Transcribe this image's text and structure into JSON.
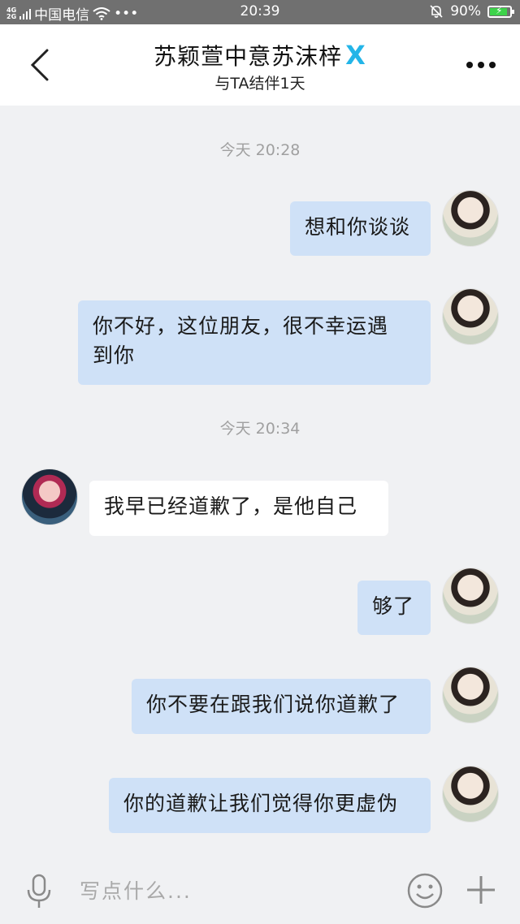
{
  "status_bar": {
    "network_top": "4G",
    "network_bottom": "2G",
    "carrier": "中国电信",
    "extra": "•••",
    "time": "20:39",
    "battery": "90%",
    "battery_level": 0.9
  },
  "header": {
    "title": "苏颖萱中意苏沫梓",
    "badge": "X",
    "subtitle": "与TA结伴1天"
  },
  "messages": [
    {
      "type": "time",
      "text": "今天 20:28"
    },
    {
      "type": "out",
      "text": "想和你谈谈"
    },
    {
      "type": "out",
      "text": "你不好，这位朋友，很不幸运遇到你"
    },
    {
      "type": "time",
      "text": "今天 20:34"
    },
    {
      "type": "in",
      "text": "我早已经道歉了，是他自己"
    },
    {
      "type": "out",
      "text": "够了"
    },
    {
      "type": "out",
      "text": "你不要在跟我们说你道歉了"
    },
    {
      "type": "out",
      "text": "你的道歉让我们觉得你更虚伪"
    }
  ],
  "input": {
    "placeholder": "写点什么..."
  },
  "colors": {
    "outgoing_bubble": "#cfe1f7",
    "incoming_bubble": "#ffffff",
    "badge": "#23b5e8"
  }
}
